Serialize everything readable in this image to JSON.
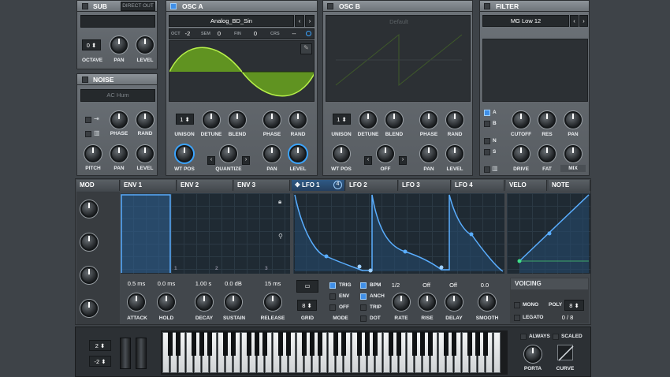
{
  "sub": {
    "title": "SUB",
    "direct_out": "DIRECT OUT",
    "octave_value": "0",
    "labels": [
      "OCTAVE",
      "PAN",
      "LEVEL"
    ]
  },
  "noise": {
    "title": "NOISE",
    "type": "AC Hum",
    "labels": [
      "PITCH",
      "PAN",
      "LEVEL",
      "PHASE",
      "RAND"
    ]
  },
  "osc_a": {
    "title": "OSC A",
    "wavetable": "Analog_BD_Sin",
    "oct_label": "OCT",
    "oct": "-2",
    "sem_label": "SEM",
    "sem": "0",
    "fin_label": "FIN",
    "fin": "0",
    "crs_label": "CRS",
    "crs": "--",
    "unison": "1",
    "labels": [
      "UNISON",
      "DETUNE",
      "BLEND",
      "PHASE",
      "RAND",
      "WT POS",
      "QUANTIZE",
      "PAN",
      "LEVEL"
    ]
  },
  "osc_b": {
    "title": "OSC B",
    "wavetable": "Default",
    "unison": "1",
    "labels": [
      "UNISON",
      "DETUNE",
      "BLEND",
      "PHASE",
      "RAND",
      "WT POS",
      "OFF",
      "PAN",
      "LEVEL"
    ]
  },
  "filter": {
    "title": "FILTER",
    "type": "MG Low 12",
    "routes": [
      "A",
      "B",
      "N",
      "S"
    ],
    "labels": [
      "CUTOFF",
      "RES",
      "PAN",
      "DRIVE",
      "FAT",
      "MIX"
    ]
  },
  "tabs": {
    "mod": "MOD",
    "env1": "ENV 1",
    "env2": "ENV 2",
    "env3": "ENV 3",
    "lfo1": "LFO 1",
    "lfo1_badge": "4",
    "lfo2": "LFO 2",
    "lfo3": "LFO 3",
    "lfo4": "LFO 4",
    "velo": "VELO",
    "note": "NOTE"
  },
  "env": {
    "attack": "0.5 ms",
    "hold": "0.0 ms",
    "decay": "1.00 s",
    "sustain": "0.0 dB",
    "release": "15 ms",
    "labels": [
      "ATTACK",
      "HOLD",
      "DECAY",
      "SUSTAIN",
      "RELEASE"
    ],
    "grid_marks": [
      "1",
      "2",
      "3"
    ]
  },
  "lfo": {
    "grid_value": "8",
    "grid_label": "GRID",
    "mode_label": "MODE",
    "modes": [
      "TRIG",
      "ENV",
      "OFF"
    ],
    "opts": [
      "BPM",
      "ANCH",
      "TRIP",
      "DOT"
    ],
    "rate": "1/2",
    "rise": "Off",
    "delay": "Off",
    "smooth": "0.0",
    "labels": [
      "RATE",
      "RISE",
      "DELAY",
      "SMOOTH"
    ]
  },
  "voicing": {
    "title": "VOICING",
    "mono": "MONO",
    "poly_label": "POLY",
    "poly": "8",
    "legato": "LEGATO",
    "legato_value": "0  /  8"
  },
  "bottom": {
    "pitch_up": "2",
    "pitch_down": "-2",
    "always": "ALWAYS",
    "scaled": "SCALED",
    "porta": "PORTA",
    "curve": "CURVE"
  }
}
